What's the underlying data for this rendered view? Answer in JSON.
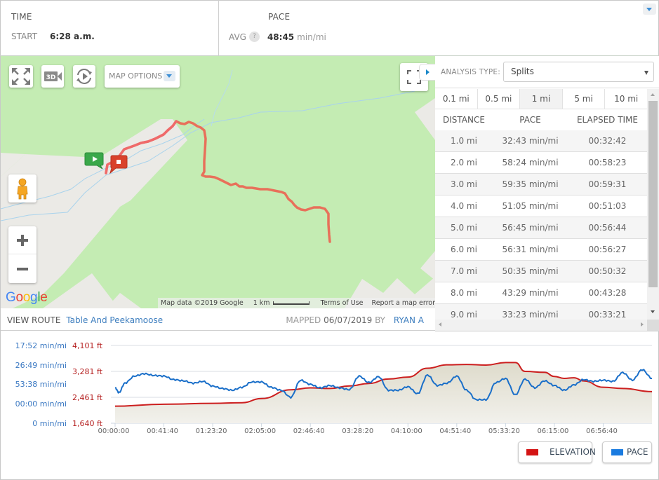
{
  "stats": {
    "time": {
      "title": "TIME",
      "start_label": "START",
      "start_value": "6:28 a.m."
    },
    "pace": {
      "title": "PACE",
      "avg_label": "AVG",
      "help": "?",
      "avg_value": "48:45",
      "avg_unit": "min/mi"
    }
  },
  "map": {
    "options_label": "MAP OPTIONS",
    "google_logo": [
      "G",
      "o",
      "o",
      "g",
      "l",
      "e"
    ],
    "attribution": "Map data ©2019 Google",
    "scale_label": "1 km",
    "terms": "Terms of Use",
    "report": "Report a map error",
    "colors": {
      "route": "#e8705a",
      "start": "#3aa84a",
      "finish": "#d9412b"
    }
  },
  "route": {
    "view_label": "VIEW ROUTE",
    "route_name": "Table And Peekamoose",
    "mapped_label": "MAPPED",
    "mapped_date": "06/07/2019",
    "by_label": "BY",
    "author": "RYAN A"
  },
  "analysis": {
    "type_label": "ANALYSIS TYPE:",
    "type_value": "Splits",
    "intervals": [
      "0.1 mi",
      "0.5 mi",
      "1 mi",
      "5 mi",
      "10 mi"
    ],
    "active_interval": "1 mi",
    "columns": [
      "DISTANCE",
      "PACE",
      "ELAPSED TIME"
    ],
    "splits": [
      {
        "distance": "1.0 mi",
        "pace": "32:43 min/mi",
        "elapsed": "00:32:42"
      },
      {
        "distance": "2.0 mi",
        "pace": "58:24 min/mi",
        "elapsed": "00:58:23"
      },
      {
        "distance": "3.0 mi",
        "pace": "59:35 min/mi",
        "elapsed": "00:59:31"
      },
      {
        "distance": "4.0 mi",
        "pace": "51:05 min/mi",
        "elapsed": "00:51:03"
      },
      {
        "distance": "5.0 mi",
        "pace": "56:45 min/mi",
        "elapsed": "00:56:44"
      },
      {
        "distance": "6.0 mi",
        "pace": "56:31 min/mi",
        "elapsed": "00:56:27"
      },
      {
        "distance": "7.0 mi",
        "pace": "50:35 min/mi",
        "elapsed": "00:50:32"
      },
      {
        "distance": "8.0 mi",
        "pace": "43:29 min/mi",
        "elapsed": "00:43:28"
      },
      {
        "distance": "9.0 mi",
        "pace": "33:23 min/mi",
        "elapsed": "00:33:21"
      }
    ]
  },
  "chart_data": {
    "type": "line",
    "title": "",
    "xlabel": "",
    "x_ticks": [
      "00:00:00",
      "00:41:40",
      "01:23:20",
      "02:05:00",
      "02:46:40",
      "03:28:20",
      "04:10:00",
      "04:51:40",
      "05:33:20",
      "06:15:00",
      "06:56:40"
    ],
    "x_range_seconds": [
      0,
      27500
    ],
    "y_left_pace_ticks": [
      "17:52 min/mi",
      "26:49 min/mi",
      "53:38 min/mi",
      "00:00 min/mi",
      "0 min/mi"
    ],
    "y_left_elev_ticks": [
      "4,101 ft",
      "3,281 ft",
      "2,461 ft",
      "1,640 ft"
    ],
    "elevation_range_ft": [
      1640,
      4101
    ],
    "grid": true,
    "legend": [
      "ELEVATION",
      "PACE"
    ],
    "legend_position": "bottom-right",
    "colors": {
      "elevation": "#cc1f1f",
      "pace": "#1a6fc9",
      "area": "#e4e2d6"
    },
    "series": [
      {
        "name": "ELEVATION",
        "unit": "ft",
        "x_seconds": [
          0,
          2500,
          5000,
          6500,
          7500,
          9000,
          10000,
          11000,
          12000,
          13000,
          14000,
          15000,
          16000,
          17000,
          18000,
          19000,
          20000,
          20500,
          21000,
          22000,
          22500,
          23000,
          23500,
          24000,
          25000,
          26000,
          27500
        ],
        "values": [
          2180,
          2240,
          2270,
          2290,
          2420,
          2700,
          2760,
          2740,
          2820,
          2900,
          3040,
          3100,
          3380,
          3490,
          3500,
          3480,
          3560,
          3560,
          3280,
          3250,
          3120,
          3060,
          3080,
          2980,
          2780,
          2740,
          2640
        ]
      },
      {
        "name": "PACE",
        "unit": "relative (0 = slowest, 1 = fastest)",
        "x_seconds": [
          0,
          200,
          500,
          1000,
          1500,
          2000,
          2500,
          3000,
          3500,
          4000,
          4500,
          5000,
          5500,
          6000,
          6500,
          7000,
          7500,
          8000,
          8500,
          9000,
          9500,
          10000,
          10500,
          11000,
          11500,
          12000,
          12500,
          13000,
          13500,
          14000,
          14500,
          15000,
          15500,
          16000,
          16500,
          17000,
          17500,
          18000,
          18500,
          19000,
          19500,
          20000,
          20500,
          21000,
          21500,
          22000,
          22500,
          23000,
          23500,
          24000,
          24500,
          25000,
          25500,
          26000,
          26500,
          27000,
          27500
        ],
        "values": [
          0.44,
          0.36,
          0.52,
          0.64,
          0.68,
          0.65,
          0.64,
          0.58,
          0.56,
          0.52,
          0.55,
          0.47,
          0.43,
          0.4,
          0.45,
          0.54,
          0.54,
          0.45,
          0.4,
          0.28,
          0.57,
          0.5,
          0.44,
          0.48,
          0.44,
          0.41,
          0.64,
          0.53,
          0.63,
          0.4,
          0.4,
          0.46,
          0.34,
          0.66,
          0.48,
          0.52,
          0.64,
          0.4,
          0.24,
          0.24,
          0.53,
          0.6,
          0.32,
          0.59,
          0.44,
          0.56,
          0.48,
          0.4,
          0.49,
          0.58,
          0.55,
          0.57,
          0.55,
          0.7,
          0.57,
          0.75,
          0.6
        ]
      }
    ]
  },
  "icons": {
    "fullscreen": "expand-arrows-icon",
    "3d": "3d-camera-icon",
    "rotate": "rotate-icon",
    "pegman": "street-view-pegman-icon",
    "zoom_in": "plus-icon",
    "zoom_out": "minus-icon"
  }
}
